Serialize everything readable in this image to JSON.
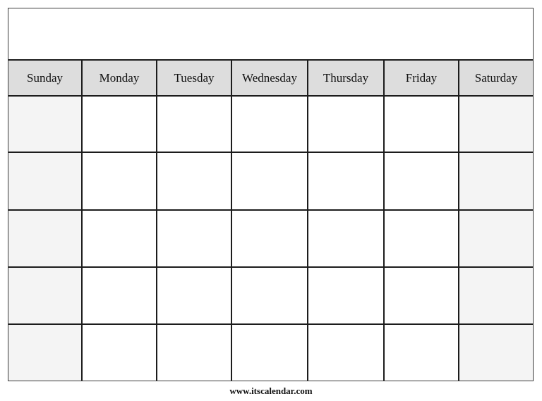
{
  "calendar": {
    "title": "",
    "weekdays": [
      "Sunday",
      "Monday",
      "Tuesday",
      "Wednesday",
      "Thursday",
      "Friday",
      "Saturday"
    ],
    "weeks": 5,
    "colors": {
      "header_bg": "#dddddd",
      "weekend_bg": "#f4f4f4",
      "weekday_bg": "#ffffff",
      "grid_line": "#1c1c1c"
    }
  },
  "footer": {
    "website": "www.itscalendar.com"
  }
}
